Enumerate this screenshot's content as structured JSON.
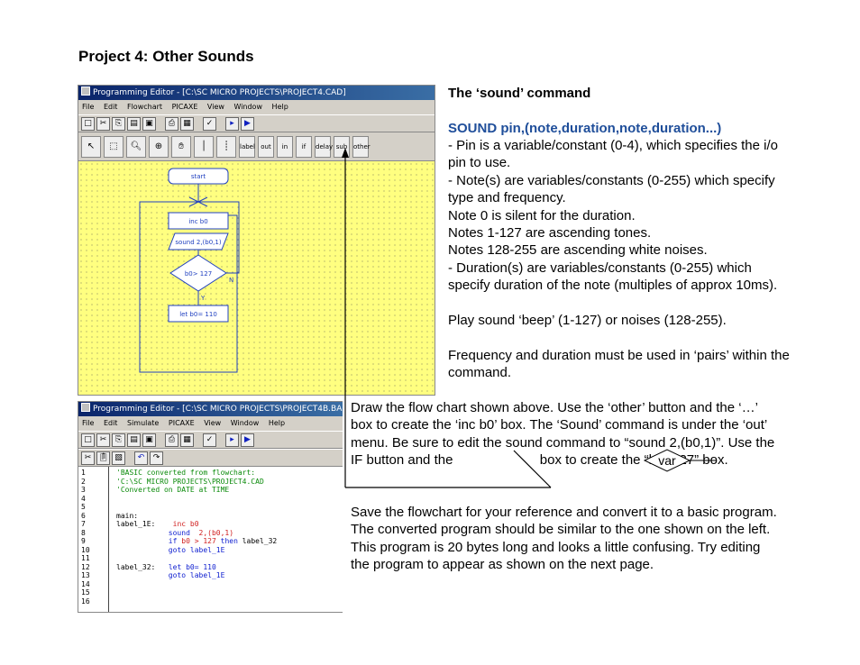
{
  "page": {
    "title": "Project 4: Other Sounds"
  },
  "flow_window": {
    "title": "Programming Editor  - [C:\\SC MICRO PROJECTS\\PROJECT4.CAD]",
    "menu": [
      "File",
      "Edit",
      "Flowchart",
      "PICAXE",
      "View",
      "Window",
      "Help"
    ],
    "toolbar_icons": [
      "new-icon",
      "cut-icon",
      "copy-icon",
      "open-icon",
      "save-icon",
      "print-icon",
      "print-setup-icon",
      "check-syntax-icon",
      "program-icon",
      "run-icon"
    ],
    "tools": {
      "label_btn": "label",
      "out_btn": "out",
      "in_btn": "in",
      "if_btn": "if",
      "delay_btn": "delay",
      "sub_btn": "sub",
      "other_btn": "other"
    },
    "flowchart": {
      "start": "start",
      "inc": "inc b0",
      "sound": "sound  2,(b0,1)",
      "decision": "b0> 127",
      "yes": "Y",
      "no": "N",
      "let": "let b0= 110"
    }
  },
  "code_window": {
    "title": "Programming Editor  - [C:\\SC MICRO PROJECTS\\PROJECT4B.BA",
    "menu": [
      "File",
      "Edit",
      "Simulate",
      "PICAXE",
      "View",
      "Window",
      "Help"
    ],
    "lines": {
      "l1": "'BASIC converted from flowchart:",
      "l2": "'C:\\SC MICRO PROJECTS\\PROJECT4.CAD",
      "l3": "'Converted on DATE at TIME",
      "l6": "main:",
      "l7_label": "label_1E:",
      "l7_code": "inc b0",
      "l8_kw": "sound",
      "l8_args": "2,(b0,1)",
      "l9_kw": "if",
      "l9_cond": "b0 > 127",
      "l9_then": "then",
      "l9_target": "label_32",
      "l10": "goto label_1E",
      "l12_label": "label_32:",
      "l12_code": "let b0= 110",
      "l13": "goto label_1E"
    },
    "line_numbers": "1\n2\n3\n4\n5\n6\n7\n8\n9\n10\n11\n12\n13\n14\n15\n16"
  },
  "content": {
    "heading": "The ‘sound’ command",
    "syntax": "SOUND pin,(note,duration,note,duration...)",
    "desc": [
      "- Pin is a variable/constant (0-4), which specifies the i/o pin to use.",
      "- Note(s) are variables/constants (0-255) which specify type and frequency.",
      "Note 0 is silent for the duration.",
      "Notes 1-127 are ascending tones.",
      "Notes 128-255 are ascending white noises.",
      "- Duration(s) are variables/constants (0-255) which specify duration of the note (multiples of approx 10ms)."
    ],
    "play": "Play sound ‘beep’ (1-127) or noises (128-255).",
    "freq": "Frequency and duration must be used in ‘pairs’ within the command.",
    "instructions_1": "Draw the flow chart shown above. Use the ‘other’ button and the ‘…’ box to create the ‘inc b0’ box. The ‘Sound’ command is under the ‘out’ menu. Be sure to edit the sound command to “sound 2,(b0,1)”. Use the IF button and the",
    "var_symbol": "var",
    "instructions_2": "box to create the “b0>127” box.",
    "save_para": "Save the flowchart for your reference and convert it to a basic program. The converted program should be similar to the one shown on the left. This program is 20 bytes long and looks a little confusing. Try editing the program to appear as shown on the next page."
  }
}
